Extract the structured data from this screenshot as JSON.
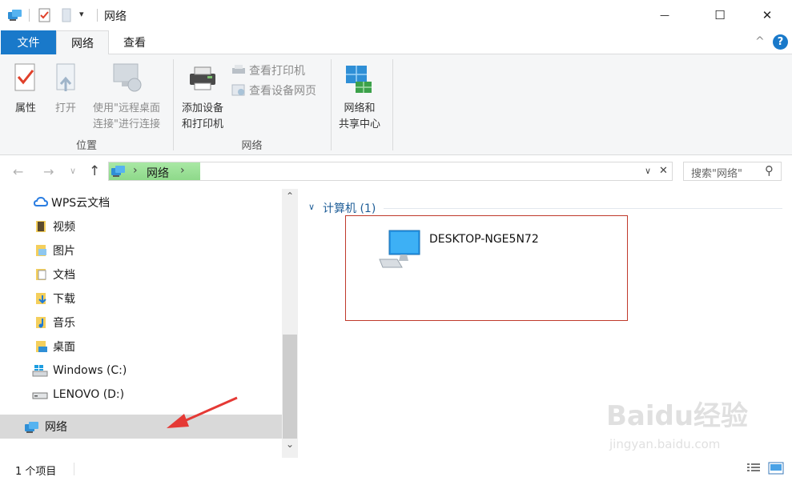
{
  "titlebar": {
    "title": "网络",
    "dropdown_glyph": "▾",
    "minimize_glyph": "—",
    "maximize_glyph": "☐",
    "close_glyph": "✕"
  },
  "tabs": [
    {
      "label": "文件"
    },
    {
      "label": "网络"
    },
    {
      "label": "查看"
    }
  ],
  "ribbon": {
    "help_glyph": "?",
    "collapse_glyph": "^",
    "location_group": {
      "label": "位置",
      "properties": "属性",
      "open": "打开",
      "remote_desktop_line1": "使用\"远程桌面",
      "remote_desktop_line2": "连接\"进行连接"
    },
    "network_group": {
      "label": "网络",
      "add_devices_line1": "添加设备",
      "add_devices_line2": "和打印机",
      "view_printers": "查看打印机",
      "view_device_page": "查看设备网页"
    },
    "center_group": {
      "line1": "网络和",
      "line2": "共享中心"
    }
  },
  "address_bar": {
    "back_glyph": "←",
    "forward_glyph": "→",
    "history_glyph": "∨",
    "up_glyph": "↑",
    "crumb_sep1": "›",
    "crumb_label": "网络",
    "crumb_sep2": "›",
    "dropdown_glyph": "∨",
    "clear_glyph": "✕",
    "search_placeholder": "搜索\"网络\"",
    "search_glyph": "⚲"
  },
  "nav_pane": {
    "items": [
      {
        "label": "WPS云文档",
        "icon": "cloud-icon"
      },
      {
        "label": "视频",
        "icon": "videos-folder-icon"
      },
      {
        "label": "图片",
        "icon": "pictures-folder-icon"
      },
      {
        "label": "文档",
        "icon": "documents-folder-icon"
      },
      {
        "label": "下载",
        "icon": "downloads-folder-icon"
      },
      {
        "label": "音乐",
        "icon": "music-folder-icon"
      },
      {
        "label": "桌面",
        "icon": "desktop-folder-icon"
      },
      {
        "label": "Windows (C:)",
        "icon": "windows-drive-icon"
      },
      {
        "label": "LENOVO (D:)",
        "icon": "drive-icon"
      },
      {
        "label": "网络",
        "icon": "network-icon"
      }
    ],
    "scroll_up_glyph": "⌃",
    "scroll_down_glyph": "⌄"
  },
  "content": {
    "group_toggle_glyph": "∨",
    "group_header": "计算机 (1)",
    "computer_name": "DESKTOP-NGE5N72"
  },
  "status_bar": {
    "item_count": "1 个项目"
  },
  "watermark": {
    "line1": "Baidu经验",
    "line2": "jingyan.baidu.com"
  },
  "colors": {
    "accent": "#1979ca",
    "highlight_border": "#c0392b",
    "arrow": "#e53935",
    "crumb_green": "#93dd8f",
    "link_blue": "#1e5d97"
  }
}
